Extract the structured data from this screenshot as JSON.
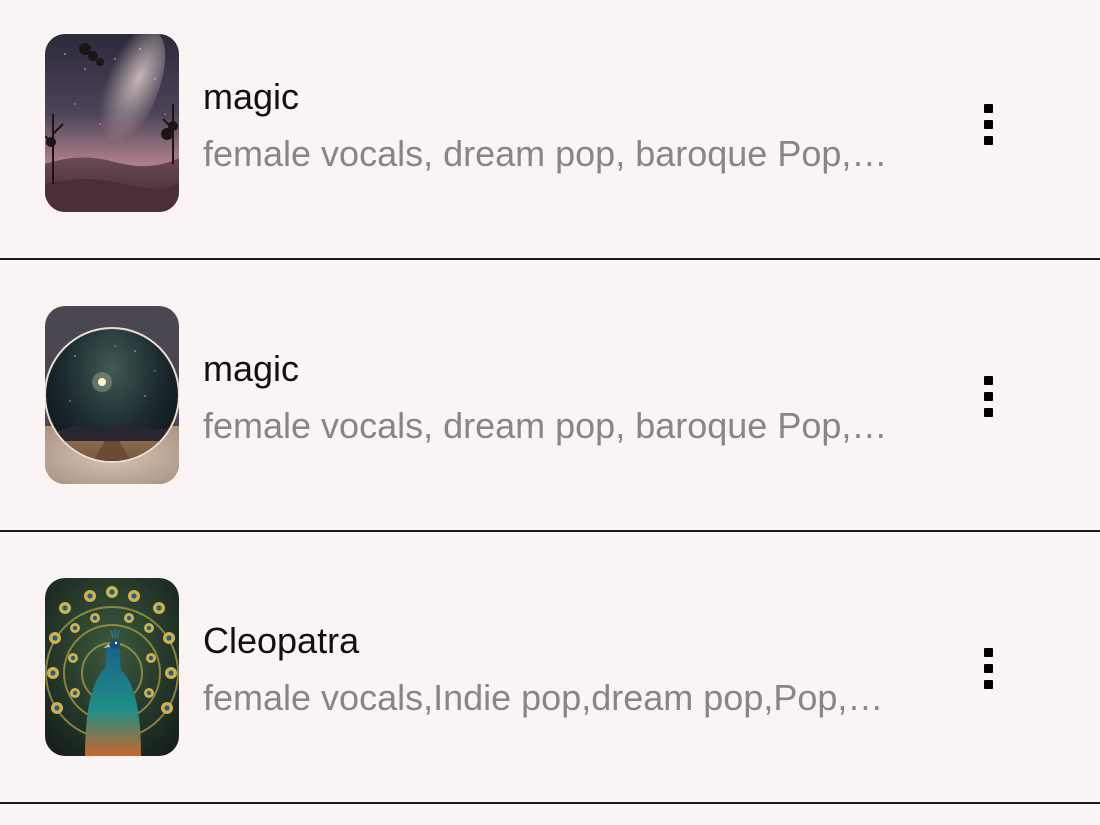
{
  "songs": [
    {
      "title": "magic",
      "tags": "female vocals, dream pop, baroque Pop, ethereal",
      "cover": "milky-way-landscape",
      "menu_icon": "more-vert-icon"
    },
    {
      "title": "magic",
      "tags": "female vocals, dream pop, baroque Pop, ethereal",
      "cover": "night-sky-road",
      "menu_icon": "more-vert-icon"
    },
    {
      "title": "Cleopatra",
      "tags": "female vocals,Indie pop,dream pop,Pop, ethereal",
      "cover": "peacock",
      "menu_icon": "more-vert-icon"
    }
  ],
  "colors": {
    "background": "#fbf4f4",
    "title": "#111111",
    "subtitle": "#8a8585",
    "divider": "#1a1a1a"
  }
}
